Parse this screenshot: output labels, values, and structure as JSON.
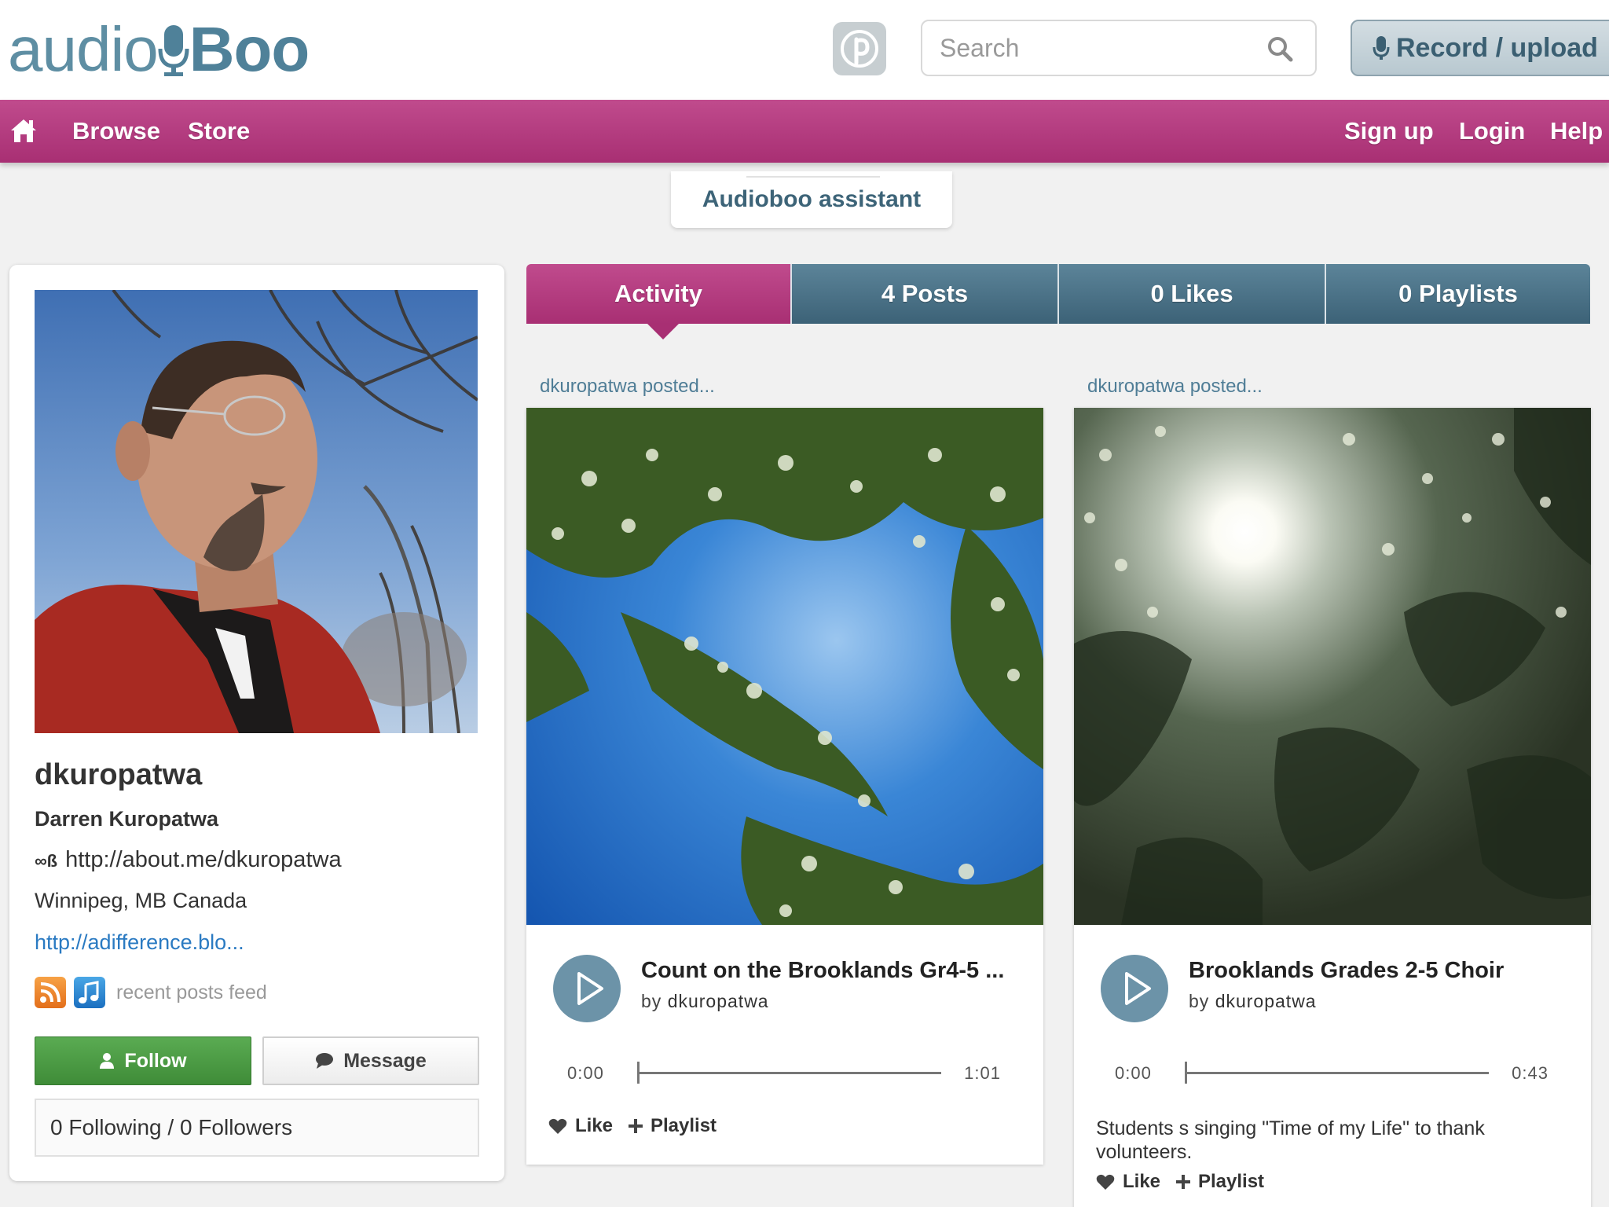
{
  "header": {
    "logo_light": "audio",
    "logo_bold": "Boo",
    "search_placeholder": "Search",
    "record_label": "Record / upload"
  },
  "nav": {
    "items": [
      "Browse",
      "Store"
    ],
    "right_items": [
      "Sign up",
      "Login",
      "Help"
    ]
  },
  "assistant_label": "Audioboo assistant",
  "profile": {
    "username": "dkuropatwa",
    "full_name": "Darren Kuropatwa",
    "aboutme_icon_text": "∞ß",
    "aboutme_url": "http://about.me/dkuropatwa",
    "location": "Winnipeg, MB Canada",
    "website": "http://adifference.blo...",
    "feed_label": "recent posts feed",
    "follow_label": "Follow",
    "message_label": "Message",
    "follow_stats": "0 Following / 0 Followers"
  },
  "tabs": [
    {
      "label": "Activity",
      "active": true
    },
    {
      "label": "4 Posts"
    },
    {
      "label": "0 Likes"
    },
    {
      "label": "0 Playlists"
    }
  ],
  "posts": [
    {
      "meta": "dkuropatwa posted...",
      "title": "Count on the Brooklands Gr4-5 ...",
      "by_prefix": "by",
      "author": "dkuropatwa",
      "time_start": "0:00",
      "time_end": "1:01",
      "progress": 0,
      "description": "",
      "like_label": "Like",
      "playlist_label": "Playlist"
    },
    {
      "meta": "dkuropatwa posted...",
      "title": "Brooklands Grades 2-5 Choir",
      "by_prefix": "by",
      "author": "dkuropatwa",
      "time_start": "0:00",
      "time_end": "0:43",
      "progress": 0,
      "description": "Students s singing \"Time of my Life\" to thank volunteers.",
      "like_label": "Like",
      "playlist_label": "Playlist"
    }
  ],
  "colors": {
    "brand_magenta": "#b43b80",
    "tab_slate": "#4c7287",
    "follow_green": "#4c9c45",
    "link_blue": "#2a7ac2"
  }
}
